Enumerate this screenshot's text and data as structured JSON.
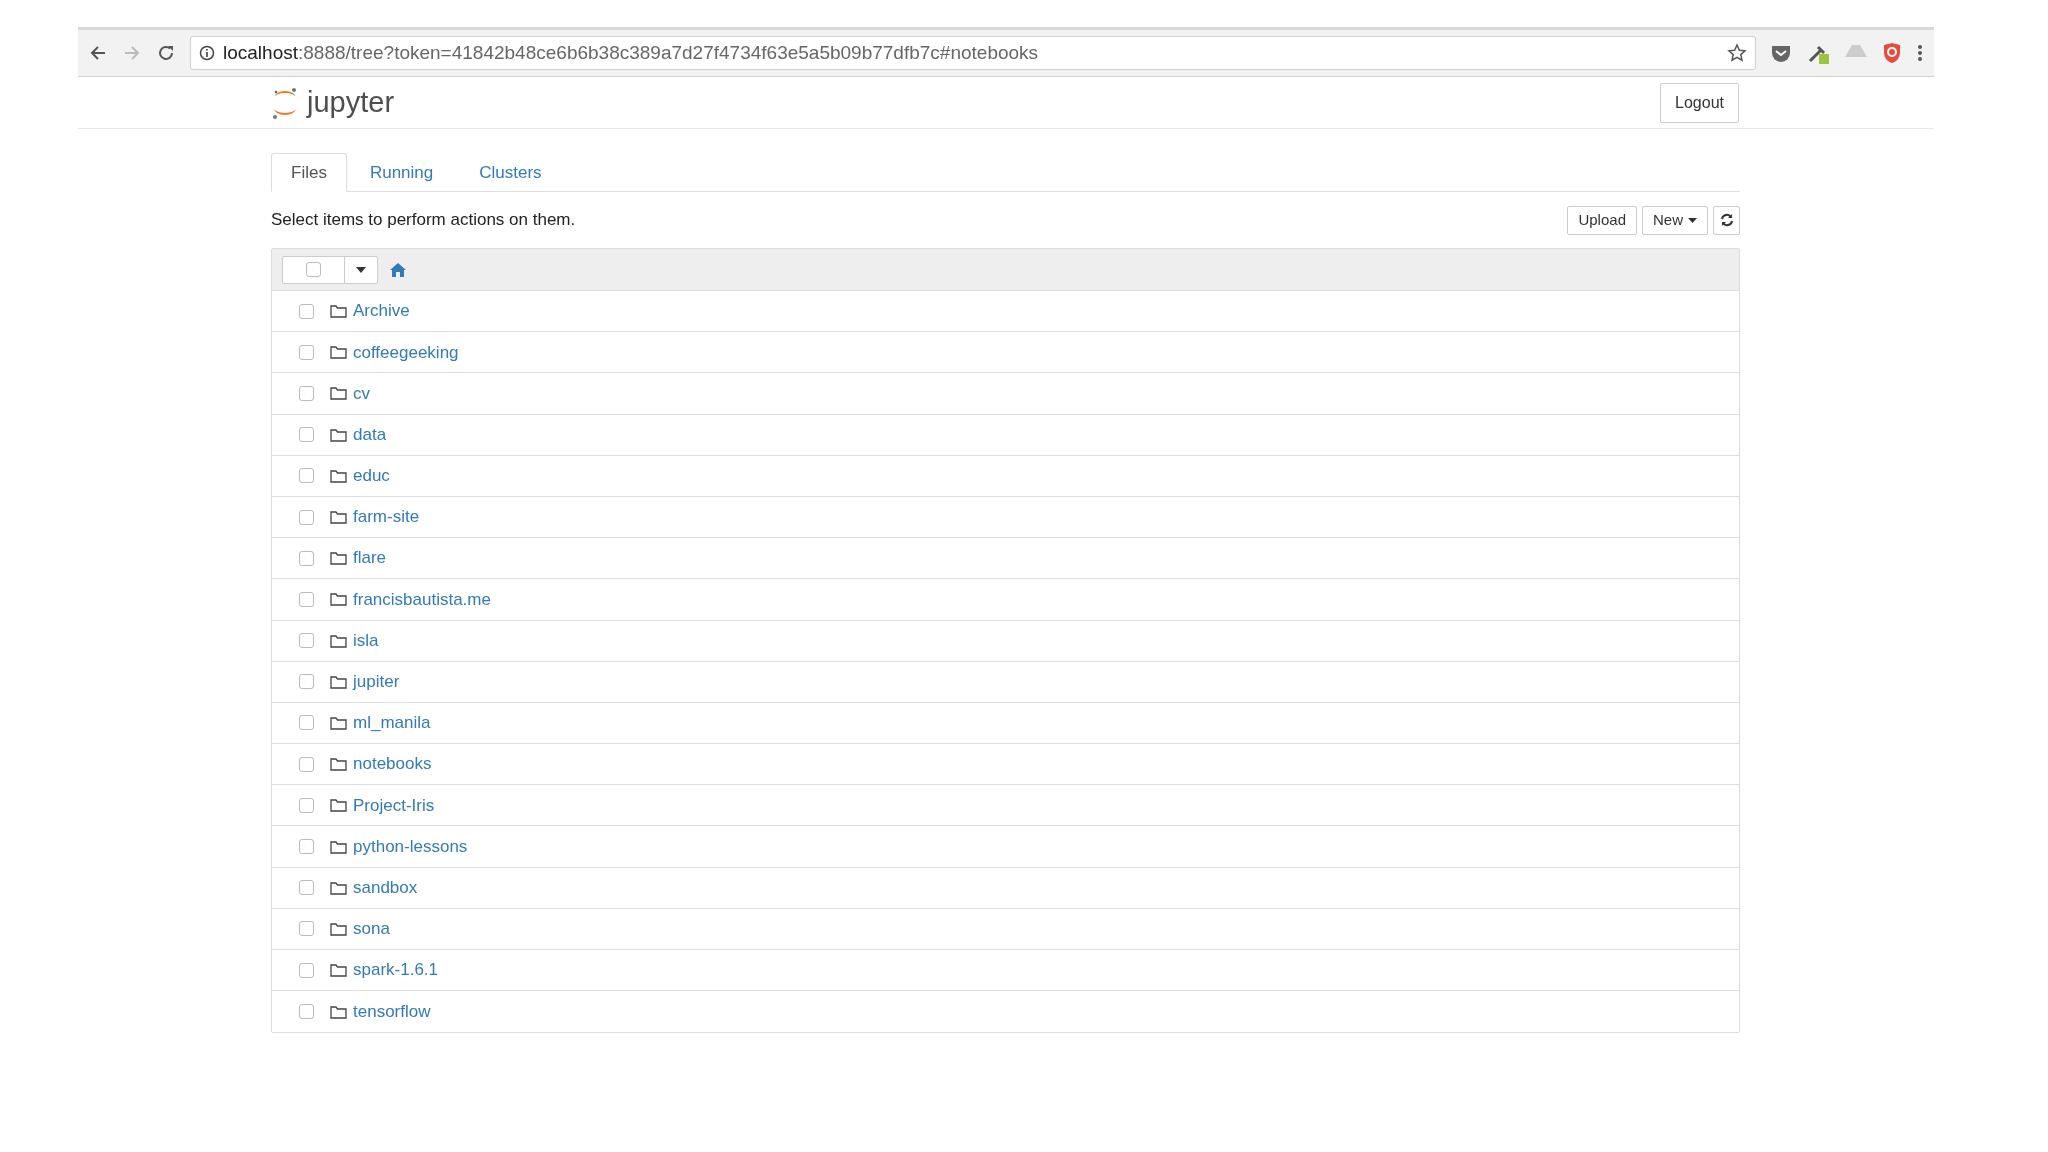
{
  "browser": {
    "url_host": "localhost",
    "url_rest": ":8888/tree?token=41842b48ce6b6b38c389a7d27f4734f63e5a5b09b77dfb7c#notebooks"
  },
  "header": {
    "logo_text": "jupyter",
    "logout": "Logout"
  },
  "tabs": [
    {
      "label": "Files",
      "selected": true
    },
    {
      "label": "Running",
      "selected": false
    },
    {
      "label": "Clusters",
      "selected": false
    }
  ],
  "toolbar": {
    "hint": "Select items to perform actions on them.",
    "buttons": [
      "Upload",
      "New"
    ]
  },
  "select_all": {
    "checked": false
  },
  "items": [
    {
      "name": "Archive",
      "checked": false
    },
    {
      "name": "coffeegeeking",
      "checked": false
    },
    {
      "name": "cv",
      "checked": false
    },
    {
      "name": "data",
      "checked": false
    },
    {
      "name": "educ",
      "checked": false
    },
    {
      "name": "farm-site",
      "checked": false
    },
    {
      "name": "flare",
      "checked": false
    },
    {
      "name": "francisbautista.me",
      "checked": false
    },
    {
      "name": "isla",
      "checked": false
    },
    {
      "name": "jupiter",
      "checked": false
    },
    {
      "name": "ml_manila",
      "checked": false
    },
    {
      "name": "notebooks",
      "checked": false
    },
    {
      "name": "Project-Iris",
      "checked": false
    },
    {
      "name": "python-lessons",
      "checked": false
    },
    {
      "name": "sandbox",
      "checked": false
    },
    {
      "name": "sona",
      "checked": false
    },
    {
      "name": "spark-1.6.1",
      "checked": false
    },
    {
      "name": "tensorflow",
      "checked": false
    }
  ]
}
